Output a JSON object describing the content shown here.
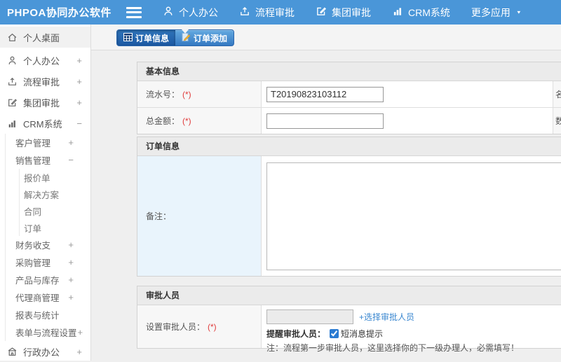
{
  "topbar": {
    "title": "PHPOA协同办公软件",
    "nav": [
      {
        "label": "个人办公"
      },
      {
        "label": "流程审批"
      },
      {
        "label": "集团审批"
      },
      {
        "label": "CRM系统"
      },
      {
        "label": "更多应用"
      }
    ]
  },
  "sidebar": {
    "items": [
      {
        "label": "个人桌面"
      },
      {
        "label": "个人办公",
        "expand": "+"
      },
      {
        "label": "流程审批",
        "expand": "+"
      },
      {
        "label": "集团审批",
        "expand": "+"
      },
      {
        "label": "CRM系统",
        "expand": "−"
      },
      {
        "label": "客户管理",
        "expand": "+"
      },
      {
        "label": "销售管理",
        "expand": "−"
      },
      {
        "label": "报价单"
      },
      {
        "label": "解决方案"
      },
      {
        "label": "合同"
      },
      {
        "label": "订单"
      },
      {
        "label": "财务收支",
        "expand": "+"
      },
      {
        "label": "采购管理",
        "expand": "+"
      },
      {
        "label": "产品与库存",
        "expand": "+"
      },
      {
        "label": "代理商管理",
        "expand": "+"
      },
      {
        "label": "报表与统计"
      },
      {
        "label": "表单与流程设置",
        "expand": "+"
      },
      {
        "label": "行政办公",
        "expand": "+"
      }
    ]
  },
  "tabs": [
    {
      "label": "订单信息"
    },
    {
      "label": "订单添加"
    }
  ],
  "form": {
    "sections": {
      "basic": {
        "title": "基本信息",
        "rows": [
          {
            "label": "流水号：",
            "required": "(*)",
            "value": "T20190823103112",
            "side": "名"
          },
          {
            "label": "总金额：",
            "required": "(*)",
            "value": "",
            "side": "数"
          }
        ]
      },
      "order": {
        "title": "订单信息",
        "remark_label": "备注："
      },
      "approver": {
        "title": "审批人员",
        "label": "设置审批人员：",
        "required": "(*)",
        "choose_link": "+选择审批人员",
        "remind_label": "提醒审批人员：",
        "sms_label": "短消息提示",
        "note": "注：流程第一步审批人员，这里选择你的下一级办理人，必需填写！"
      }
    }
  },
  "colors": {
    "topbar_blue": "#4a96d8",
    "tab_active_blue": "#1c59a3",
    "link_blue": "#3a87d0",
    "required_red": "#e03c3c",
    "remark_cell_blue": "#e9f4fc"
  }
}
